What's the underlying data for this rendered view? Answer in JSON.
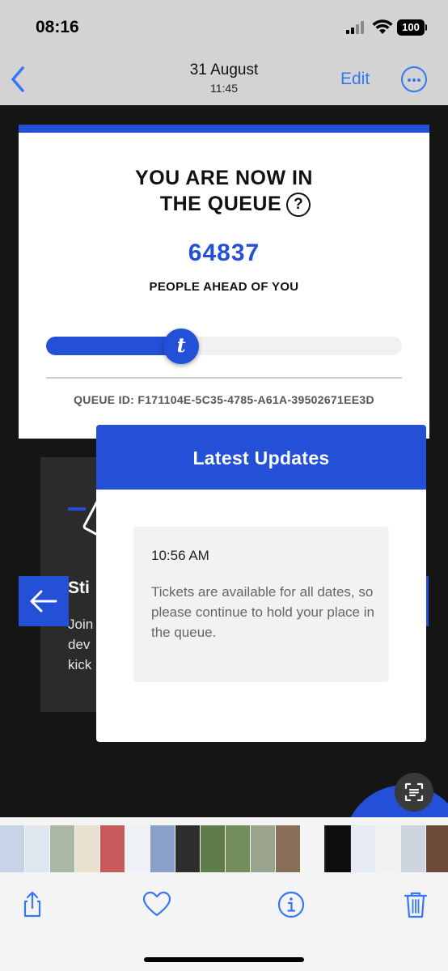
{
  "status_bar": {
    "time": "08:16",
    "battery": "100"
  },
  "photo_nav": {
    "date": "31 August",
    "time": "11:45",
    "edit_label": "Edit"
  },
  "queue": {
    "title_line1": "YOU ARE NOW IN",
    "title_line2": "THE QUEUE",
    "help_symbol": "?",
    "people_ahead": "64837",
    "people_ahead_label": "PEOPLE AHEAD OF YOU",
    "progress_percent": 38,
    "knob_letter": "t",
    "queue_id": "QUEUE ID: F171104E-5C35-4785-A61A-39502671EE3D"
  },
  "background_card": {
    "heading": "Sti",
    "text_lines": [
      "Join",
      "dev",
      "kick"
    ]
  },
  "updates": {
    "header": "Latest Updates",
    "items": [
      {
        "time": "10:56 AM",
        "text": "Tickets are available for all dates, so please continue to hold your place in the queue."
      }
    ]
  },
  "colors": {
    "accent": "#2350d6",
    "ios_blue": "#3478f6",
    "bar_bg": "#d3d3d3",
    "photo_bg": "#151515"
  },
  "filmstrip": {
    "thumbnail_colors": [
      "#c7d3e6",
      "#dfe6ef",
      "#a9b8a5",
      "#e9e1cf",
      "#c75a5a",
      "#eef1f6",
      "#8aa0c8",
      "#2d2d2d",
      "#5f7d4a",
      "#748e5b",
      "#9aa38e",
      "#8a6f58",
      "#f4f4f4",
      "#2350d6",
      "#e6eaf2",
      "#f1f1f1",
      "#cfd5de",
      "#6b4b3a",
      "#c79a6b",
      "#b47b58",
      "#a88b6e",
      "#d49a6a",
      "#57707a",
      "#3f5a3a",
      "#e6c23a",
      "#7ea04a",
      "#c0a060"
    ]
  },
  "toolbar_icons": [
    "share-icon",
    "heart-icon",
    "info-icon",
    "trash-icon"
  ]
}
